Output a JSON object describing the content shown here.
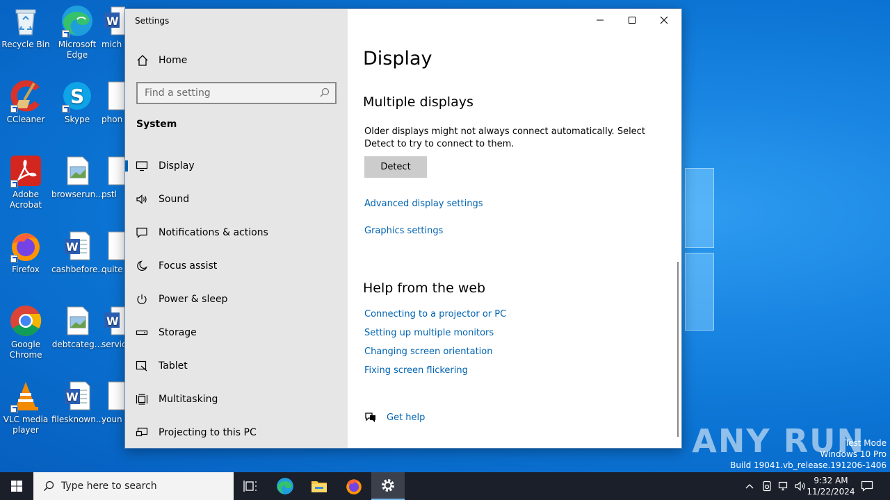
{
  "desktop": {
    "icons": [
      {
        "label": "Recycle Bin",
        "shortcut": false
      },
      {
        "label": "Microsoft Edge",
        "shortcut": true
      },
      {
        "label": "mich",
        "shortcut": false
      },
      {
        "label": "CCleaner",
        "shortcut": true
      },
      {
        "label": "Skype",
        "shortcut": true
      },
      {
        "label": "phon",
        "shortcut": false
      },
      {
        "label": "Adobe Acrobat",
        "shortcut": true
      },
      {
        "label": "browserun...",
        "shortcut": false
      },
      {
        "label": "pstl",
        "shortcut": false
      },
      {
        "label": "Firefox",
        "shortcut": true
      },
      {
        "label": "cashbefore...",
        "shortcut": false
      },
      {
        "label": "quite",
        "shortcut": false
      },
      {
        "label": "Google Chrome",
        "shortcut": true
      },
      {
        "label": "debtcateg...",
        "shortcut": false
      },
      {
        "label": "servic",
        "shortcut": false
      },
      {
        "label": "VLC media player",
        "shortcut": true
      },
      {
        "label": "filesknown...",
        "shortcut": false
      },
      {
        "label": "youn",
        "shortcut": false
      }
    ],
    "watermark": "ANY RUN",
    "test_mode": {
      "line1": "Test Mode",
      "line2": "Windows 10 Pro",
      "line3": "Build 19041.vb_release.191206-1406"
    }
  },
  "settings": {
    "window_title": "Settings",
    "nav": {
      "home_label": "Home",
      "search_placeholder": "Find a setting",
      "section_title": "System",
      "items": [
        {
          "label": "Display",
          "icon": "monitor-icon",
          "selected": true
        },
        {
          "label": "Sound",
          "icon": "speaker-icon",
          "selected": false
        },
        {
          "label": "Notifications & actions",
          "icon": "notification-icon",
          "selected": false
        },
        {
          "label": "Focus assist",
          "icon": "moon-icon",
          "selected": false
        },
        {
          "label": "Power & sleep",
          "icon": "power-icon",
          "selected": false
        },
        {
          "label": "Storage",
          "icon": "storage-icon",
          "selected": false
        },
        {
          "label": "Tablet",
          "icon": "tablet-icon",
          "selected": false
        },
        {
          "label": "Multitasking",
          "icon": "multitasking-icon",
          "selected": false
        },
        {
          "label": "Projecting to this PC",
          "icon": "projecting-icon",
          "selected": false
        }
      ]
    },
    "content": {
      "page_title": "Display",
      "multiple_displays": {
        "heading": "Multiple displays",
        "description": "Older displays might not always connect automatically. Select Detect to try to connect to them.",
        "detect_label": "Detect",
        "links": [
          "Advanced display settings",
          "Graphics settings"
        ]
      },
      "help": {
        "heading": "Help from the web",
        "links": [
          "Connecting to a projector or PC",
          "Setting up multiple monitors",
          "Changing screen orientation",
          "Fixing screen flickering"
        ],
        "get_help_label": "Get help"
      }
    }
  },
  "taskbar": {
    "search_placeholder": "Type here to search",
    "apps": [
      "task-view-icon",
      "edge-icon",
      "file-explorer-icon",
      "firefox-icon",
      "settings-icon"
    ],
    "active_app": "settings-icon",
    "clock": {
      "time": "9:32 AM",
      "date": "11/22/2024"
    }
  }
}
